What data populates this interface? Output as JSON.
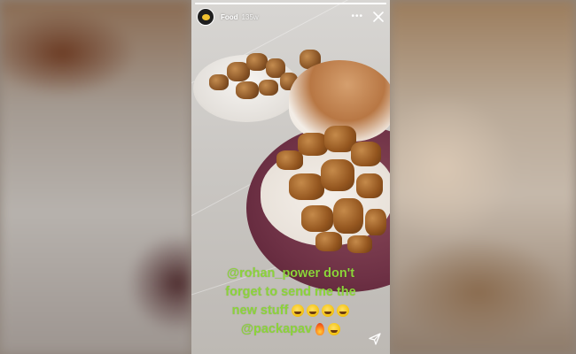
{
  "story": {
    "account_name": "Food",
    "time_ago": "135w",
    "progress_fraction": 1.0,
    "more_label": "•••",
    "caption": {
      "line1": "@rohan_power don't",
      "line2": "forget to send me the",
      "line3_text": "new stuff",
      "line3_emoji_count": 4,
      "line4_mention": "@packapav",
      "line4_emoji": [
        "fire",
        "tongue-face"
      ]
    }
  },
  "icons": {
    "close": "close-icon",
    "send": "send-icon",
    "more": "more-icon"
  },
  "colors": {
    "caption": "#8cd43a",
    "plate": "#6e3145",
    "header_text": "#ffffff"
  }
}
